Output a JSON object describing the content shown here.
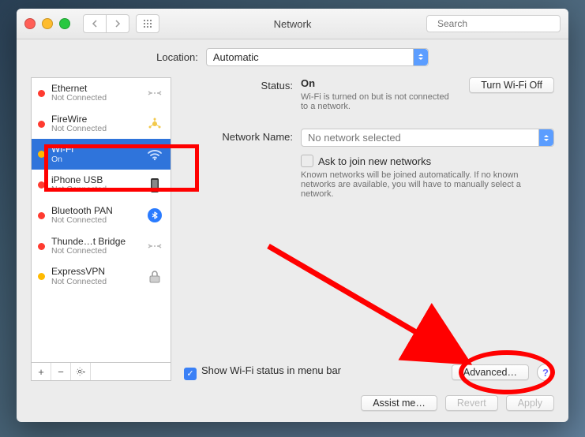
{
  "window": {
    "title": "Network",
    "search_placeholder": "Search"
  },
  "location": {
    "label": "Location:",
    "value": "Automatic"
  },
  "sidebar": {
    "items": [
      {
        "status": "red",
        "name": "Ethernet",
        "sub": "Not Connected",
        "icon": "ethernet"
      },
      {
        "status": "red",
        "name": "FireWire",
        "sub": "Not Connected",
        "icon": "firewire"
      },
      {
        "status": "yel",
        "name": "Wi-Fi",
        "sub": "On",
        "icon": "wifi",
        "selected": true
      },
      {
        "status": "red",
        "name": "iPhone USB",
        "sub": "Not Connected",
        "icon": "iphone"
      },
      {
        "status": "red",
        "name": "Bluetooth PAN",
        "sub": "Not Connected",
        "icon": "bluetooth"
      },
      {
        "status": "red",
        "name": "Thunde…t Bridge",
        "sub": "Not Connected",
        "icon": "ethernet"
      },
      {
        "status": "yel",
        "name": "ExpressVPN",
        "sub": "Not Connected",
        "icon": "vpn"
      }
    ],
    "add": "+",
    "remove": "−",
    "gear": "⚙"
  },
  "detail": {
    "status_label": "Status:",
    "status_value": "On",
    "wifi_toggle_label": "Turn Wi-Fi Off",
    "status_desc": "Wi-Fi is turned on but is not connected to a network.",
    "netname_label": "Network Name:",
    "netname_value": "No network selected",
    "ask_label": "Ask to join new networks",
    "ask_desc": "Known networks will be joined automatically. If no known networks are available, you will have to manually select a network.",
    "show_status_label": "Show Wi-Fi status in menu bar",
    "show_status_checked": true,
    "advanced_label": "Advanced…",
    "help_label": "?"
  },
  "footer": {
    "assist_label": "Assist me…",
    "revert_label": "Revert",
    "apply_label": "Apply"
  }
}
